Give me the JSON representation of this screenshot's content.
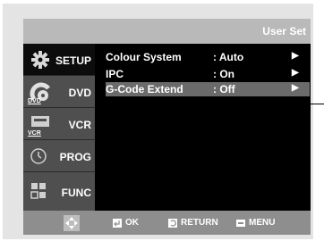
{
  "header": {
    "title": "User Set"
  },
  "sidebar": {
    "items": [
      {
        "label": "SETUP",
        "icon": "gear-icon",
        "active": true
      },
      {
        "label": "DVD",
        "icon": "dvd-disc-icon",
        "sub": "DVD"
      },
      {
        "label": "VCR",
        "icon": "vcr-icon",
        "sub": "VCR"
      },
      {
        "label": "PROG",
        "icon": "clock-icon"
      },
      {
        "label": "FUNC",
        "icon": "function-grid-icon"
      }
    ]
  },
  "menu": {
    "rows": [
      {
        "name": "Colour System",
        "value": ": Auto",
        "arrow": "▶"
      },
      {
        "name": "IPC",
        "value": ": On",
        "arrow": "▶"
      },
      {
        "name": "G-Code Extend",
        "value": ": Off",
        "arrow": "▶",
        "selected": true
      }
    ]
  },
  "footer": {
    "ok": "OK",
    "return": "RETURN",
    "menu": "MENU"
  },
  "colors": {
    "header_bg": "#b9b9b9",
    "sidebar_bg": "#4f4f4f",
    "selected_row": "#6b6b6b",
    "footer_bg": "#8e8e8e"
  }
}
